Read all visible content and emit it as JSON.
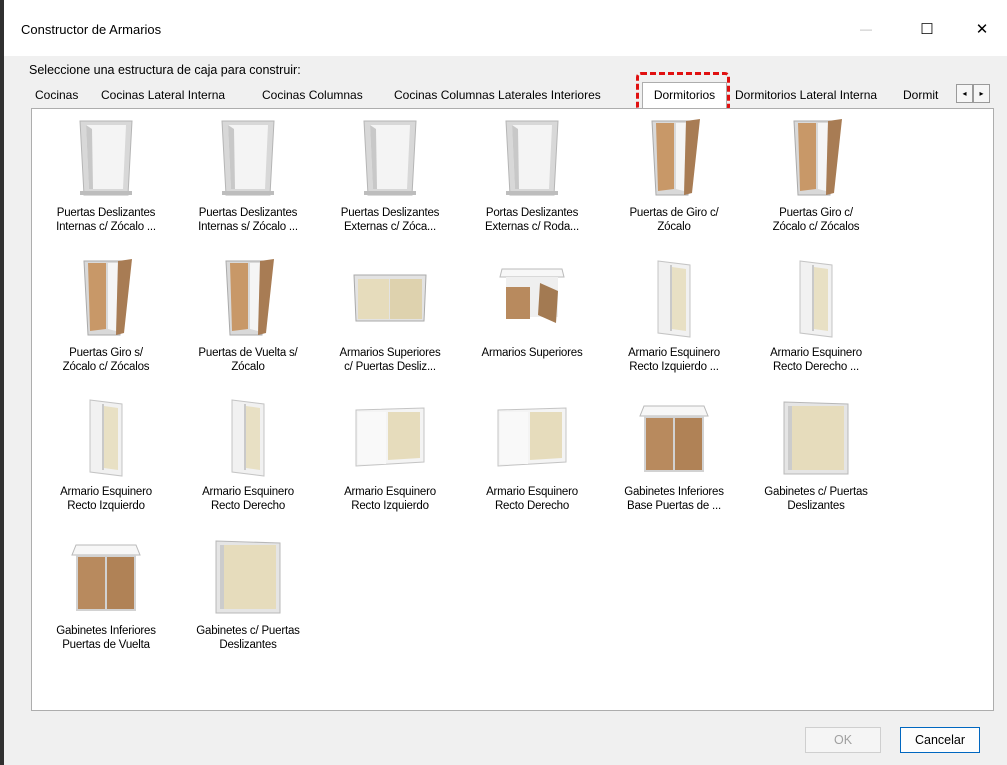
{
  "window": {
    "title": "Constructor de Armarios",
    "minimize_glyph": "—",
    "maximize_glyph": "☐",
    "close_glyph": "✕"
  },
  "prompt": "Seleccione una estructura de caja para construir:",
  "tabs": [
    {
      "label": "Cocinas"
    },
    {
      "label": "Cocinas Lateral Interna"
    },
    {
      "label": "Cocinas Columnas"
    },
    {
      "label": "Cocinas Columnas Laterales Interiores"
    },
    {
      "label": "Dormitorios"
    },
    {
      "label": "Dormitorios Lateral Interna"
    },
    {
      "label": "Dormit"
    }
  ],
  "active_tab": "Dormitorios",
  "tab_scroll": {
    "left": "◂",
    "right": "▸"
  },
  "items": [
    {
      "line1": "Puertas Deslizantes",
      "line2": "Internas c/ Zócalo ...",
      "icon": "open-wardrobe-icon"
    },
    {
      "line1": "Puertas Deslizantes",
      "line2": "Internas s/ Zócalo ...",
      "icon": "open-wardrobe-icon"
    },
    {
      "line1": "Puertas Deslizantes",
      "line2": "Externas c/ Zóca...",
      "icon": "open-wardrobe-icon"
    },
    {
      "line1": "Portas Deslizantes",
      "line2": "Externas c/ Roda...",
      "icon": "open-wardrobe-icon"
    },
    {
      "line1": "Puertas de Giro c/",
      "line2": "Zócalo",
      "icon": "hinged-door-wardrobe-icon"
    },
    {
      "line1": "Puertas Giro c/",
      "line2": "Zócalo c/ Zócalos",
      "icon": "hinged-door-wardrobe-icon"
    },
    {
      "line1": "Puertas Giro s/",
      "line2": "Zócalo c/ Zócalos",
      "icon": "hinged-door-wardrobe-icon"
    },
    {
      "line1": "Puertas de Vuelta s/",
      "line2": "Zócalo",
      "icon": "hinged-door-wardrobe-icon"
    },
    {
      "line1": "Armarios Superiores",
      "line2": "c/ Puertas Desliz...",
      "icon": "upper-sliding-cabinet-icon"
    },
    {
      "line1": "Armarios Superiores",
      "line2": "",
      "icon": "upper-cabinet-icon"
    },
    {
      "line1": "Armario Esquinero",
      "line2": "Recto Izquierdo ...",
      "icon": "corner-wardrobe-icon"
    },
    {
      "line1": "Armario Esquinero",
      "line2": "Recto Derecho ...",
      "icon": "corner-wardrobe-icon"
    },
    {
      "line1": "Armario Esquinero",
      "line2": "Recto Izquierdo",
      "icon": "corner-wardrobe-icon"
    },
    {
      "line1": "Armario Esquinero",
      "line2": "Recto Derecho",
      "icon": "corner-wardrobe-icon"
    },
    {
      "line1": "Armario Esquinero",
      "line2": "Recto Izquierdo",
      "icon": "corner-upper-cabinet-icon"
    },
    {
      "line1": "Armario Esquinero",
      "line2": "Recto Derecho",
      "icon": "corner-upper-cabinet-icon"
    },
    {
      "line1": "Gabinetes Inferiores",
      "line2": "Base Puertas de ...",
      "icon": "base-cabinet-icon"
    },
    {
      "line1": "Gabinetes c/ Puertas",
      "line2": "Deslizantes",
      "icon": "sliding-cabinet-icon"
    },
    {
      "line1": "Gabinetes Inferiores",
      "line2": "Puertas de Vuelta",
      "icon": "base-cabinet-icon"
    },
    {
      "line1": "Gabinetes c/ Puertas",
      "line2": "Deslizantes",
      "icon": "sliding-cabinet-icon"
    }
  ],
  "buttons": {
    "ok": "OK",
    "cancel": "Cancelar"
  },
  "colors": {
    "highlight": "#e01010",
    "wood": "#b88a5e",
    "beige_panel": "#e8e0c4",
    "carcass": "#e8e8e8"
  }
}
